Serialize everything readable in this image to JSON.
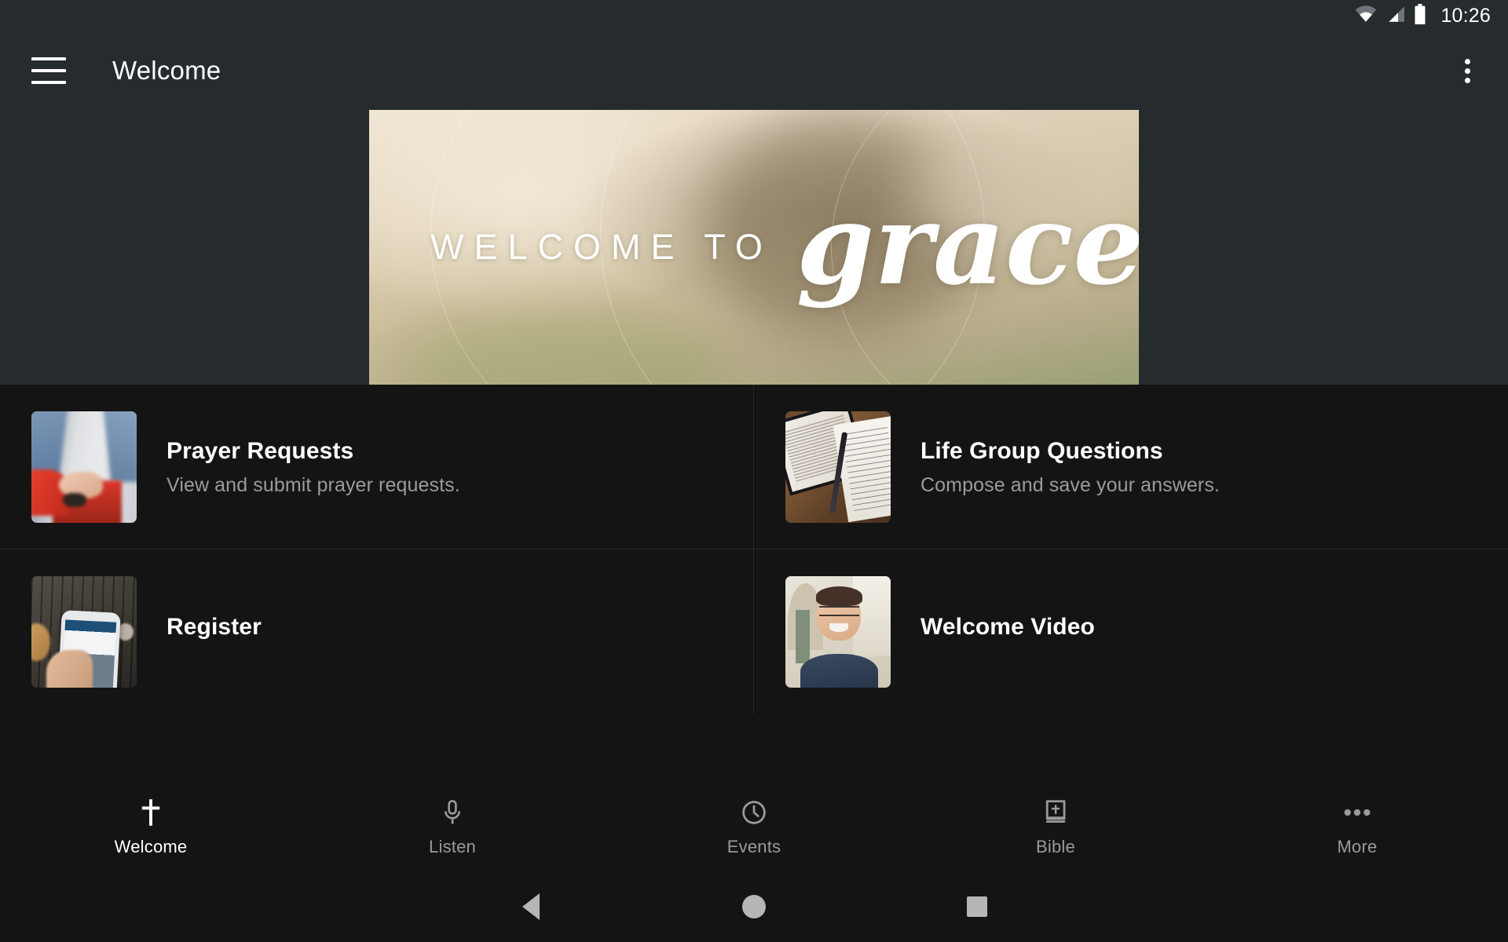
{
  "status_bar": {
    "time": "10:26",
    "icons": [
      "wifi-icon",
      "cell-signal-icon",
      "battery-icon"
    ]
  },
  "app_bar": {
    "menu_icon": "hamburger-menu-icon",
    "title": "Welcome",
    "overflow_icon": "overflow-menu-icon"
  },
  "hero": {
    "kicker": "WELCOME TO",
    "script": "grace",
    "alt": "Blurred warm sepia photo of a church building exterior with arched entry"
  },
  "cards": [
    {
      "title": "Prayer Requests",
      "subtitle": "View and submit prayer requests.",
      "thumb": "two-people-holding-hands-photo"
    },
    {
      "title": "Life Group Questions",
      "subtitle": "Compose and save your answers.",
      "thumb": "open-bible-notepad-and-pen-photo"
    },
    {
      "title": "Register",
      "subtitle": "",
      "thumb": "hand-holding-phone-on-wood-photo"
    },
    {
      "title": "Welcome Video",
      "subtitle": "",
      "thumb": "smiling-man-with-glasses-photo"
    }
  ],
  "tabs": [
    {
      "label": "Welcome",
      "icon": "cross-icon",
      "active": true
    },
    {
      "label": "Listen",
      "icon": "microphone-icon",
      "active": false
    },
    {
      "label": "Events",
      "icon": "clock-icon",
      "active": false
    },
    {
      "label": "Bible",
      "icon": "bible-book-icon",
      "active": false
    },
    {
      "label": "More",
      "icon": "ellipsis-icon",
      "active": false
    }
  ],
  "system_nav": {
    "back": "back-triangle-icon",
    "home": "home-circle-icon",
    "recents": "recents-square-icon"
  },
  "colors": {
    "app_bar": "#262b2e",
    "page_background": "#141414",
    "primary_text": "#ffffff",
    "secondary_text": "#9b9b9b",
    "inactive_tab": "#9a9a9a",
    "system_nav_icon": "#b6b6b6"
  }
}
